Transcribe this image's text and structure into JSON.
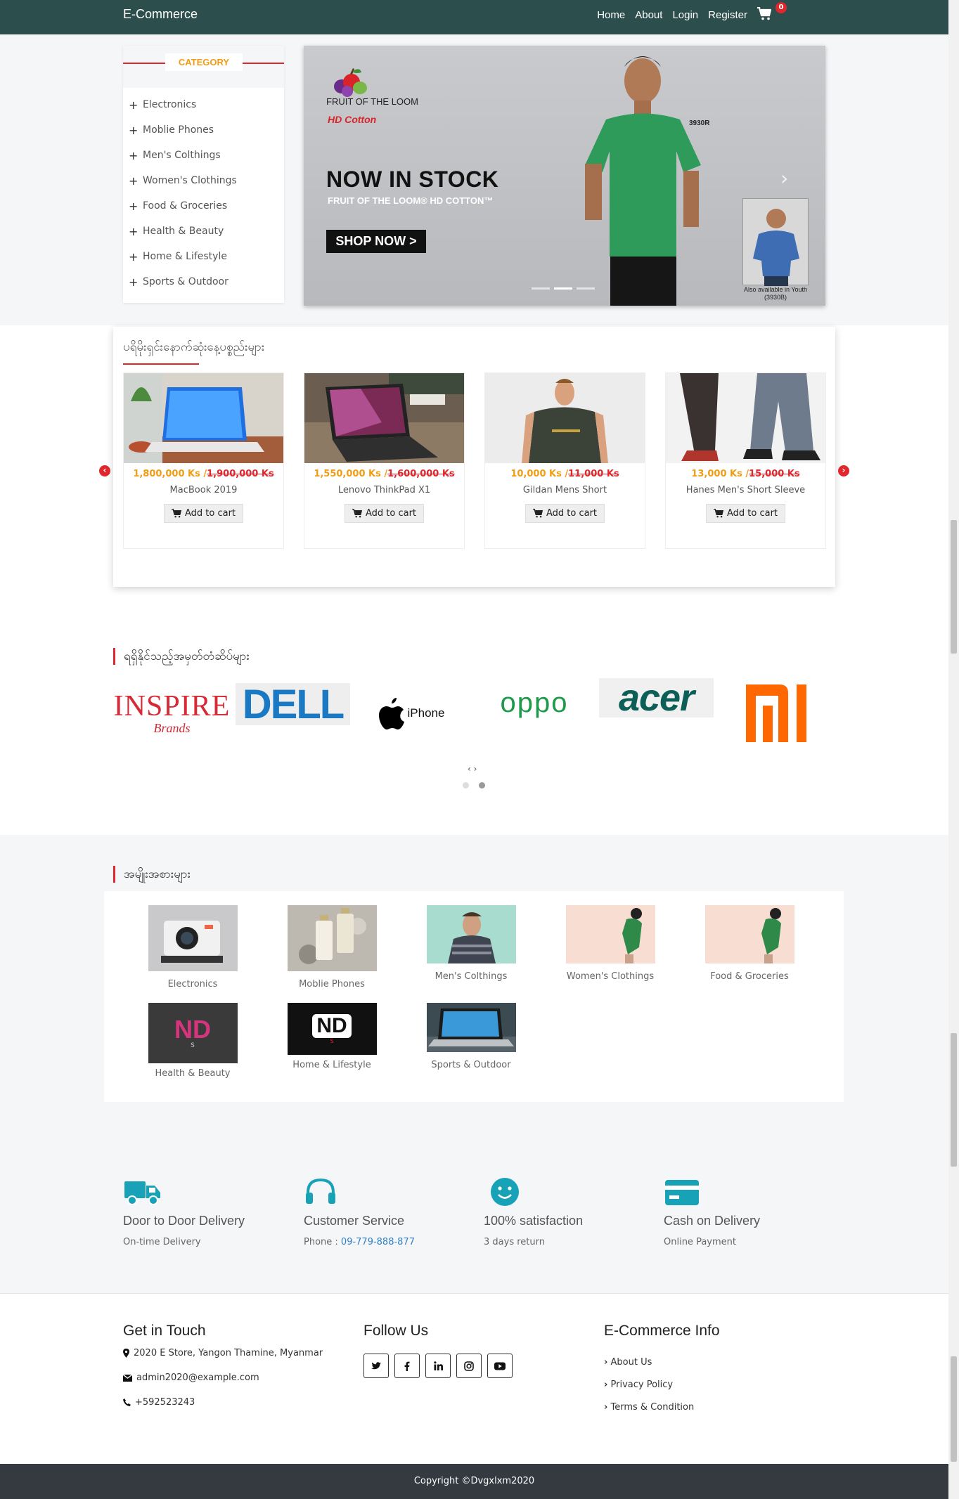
{
  "nav": {
    "brand": "E-Commerce",
    "links": [
      "Home",
      "About",
      "Login",
      "Register"
    ],
    "cart_count": "0"
  },
  "sidebar": {
    "title": "CATEGORY",
    "items": [
      "Electronics",
      "Moblie Phones",
      "Men's Colthings",
      "Women's Clothings",
      "Food & Groceries",
      "Health & Beauty",
      "Home & Lifestyle",
      "Sports & Outdoor"
    ]
  },
  "banner": {
    "logo_text": "FRUIT OF THE LOOM",
    "logo_sub": "HD Cotton",
    "headline": "NOW IN STOCK",
    "subheadline": "FRUIT OF THE LOOM® HD COTTON™",
    "cta": "SHOP NOW  >",
    "model_code": "3930R",
    "kid_caption": "Also available in Youth (3930B)",
    "slides": 3,
    "active_slide": 2
  },
  "bestsellers": {
    "title": "ပရိမိုးရှင်းနောက်ဆုံးနေ့ပစ္စည်းများ",
    "currency": "Ks",
    "add_to_cart": "Add to cart",
    "products": [
      {
        "name": "MacBook 2019",
        "price": "1,800,000 Ks",
        "old_price": "1,900,000 Ks"
      },
      {
        "name": "Lenovo ThinkPad X1",
        "price": "1,550,000 Ks",
        "old_price": "1,600,000 Ks"
      },
      {
        "name": "Gildan Mens Short",
        "price": "10,000 Ks",
        "old_price": "11,000 Ks"
      },
      {
        "name": "Hanes Men's Short Sleeve",
        "price": "13,000 Ks",
        "old_price": "15,000 Ks"
      }
    ]
  },
  "brands": {
    "title": "ရရှိနိုင်သည့်အမှတ်တံဆိပ်များ",
    "items": [
      "INSPIRE Brands",
      "DELL",
      "iPhone",
      "OPPO",
      "acer",
      "mi"
    ],
    "inspire_main": "INSPIRE",
    "inspire_sub": "Brands",
    "dell": "DELL",
    "iphone": "iPhone",
    "oppo": "oppo",
    "acer": "acer",
    "mi": "mi",
    "nav": "‹ ›"
  },
  "categories": {
    "title": "အမျိုးအစားများ",
    "items": [
      {
        "label": "Electronics"
      },
      {
        "label": "Moblie Phones"
      },
      {
        "label": "Men's Colthings"
      },
      {
        "label": "Women's Clothings"
      },
      {
        "label": "Food & Groceries"
      },
      {
        "label": "Health & Beauty",
        "logo": "ND",
        "logo_sub": "S"
      },
      {
        "label": "Home & Lifestyle",
        "logo": "ND",
        "logo_sub": "S"
      },
      {
        "label": "Sports & Outdoor"
      }
    ]
  },
  "services": [
    {
      "icon": "truck-icon",
      "title": "Door to Door Delivery",
      "sub": "On-time Delivery"
    },
    {
      "icon": "headphones-icon",
      "title": "Customer Service",
      "sub_label": "Phone : ",
      "sub_link": "09-779-888-877"
    },
    {
      "icon": "smile-icon",
      "title": "100% satisfaction",
      "sub": "3 days return"
    },
    {
      "icon": "credit-card-icon",
      "title": "Cash on Delivery",
      "sub": "Online Payment"
    }
  ],
  "footer": {
    "contact_title": "Get in Touch",
    "address": "2020 E Store, Yangon Thamine, Myanmar",
    "email": "admin2020@example.com",
    "phone": "+592523243",
    "follow_title": "Follow Us",
    "social": [
      "twitter-icon",
      "facebook-icon",
      "linkedin-icon",
      "instagram-icon",
      "youtube-icon"
    ],
    "info_title": "E-Commerce Info",
    "info_links": [
      "About Us",
      "Privacy Policy",
      "Terms & Condition"
    ],
    "copyright": "Copyright ©Dvgxlxm2020"
  },
  "colors": {
    "navbar": "#2c4e4c",
    "accent_red": "#e0272d",
    "price_orange": "#f39c12",
    "service_teal": "#17a2b8",
    "footer_dark": "#343a40"
  }
}
